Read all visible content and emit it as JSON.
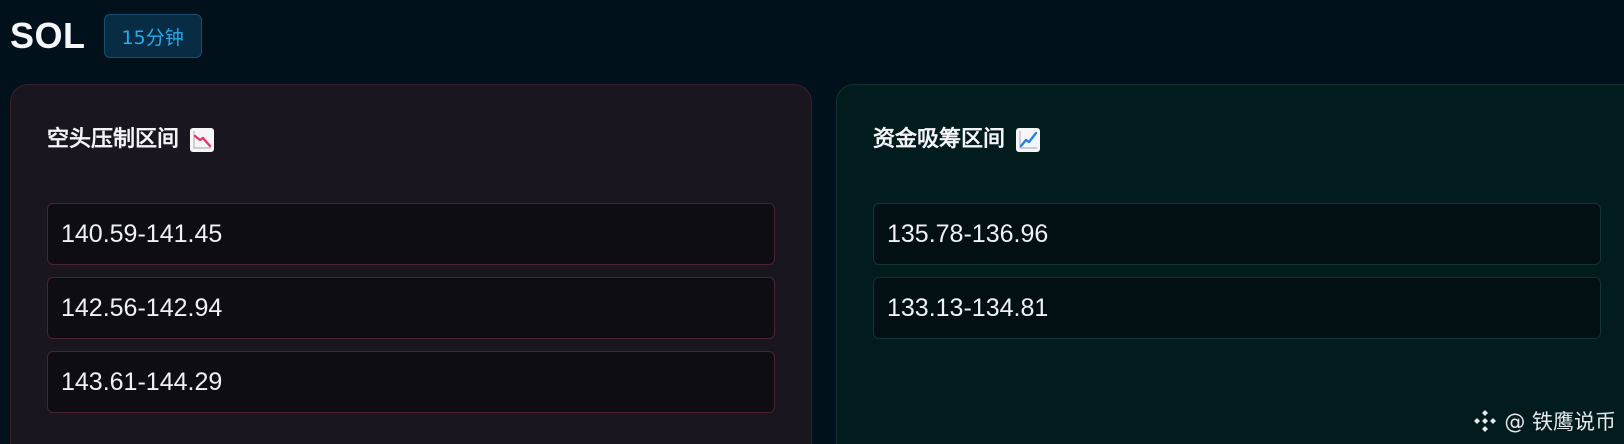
{
  "header": {
    "symbol": "SOL",
    "timeframe": "15分钟"
  },
  "short_zone": {
    "title": "空头压制区间",
    "icon": "chart-decreasing-icon",
    "ranges": [
      "140.59-141.45",
      "142.56-142.94",
      "143.61-144.29"
    ]
  },
  "long_zone": {
    "title": "资金吸筹区间",
    "icon": "chart-increasing-icon",
    "ranges": [
      "135.78-136.96",
      "133.13-134.81"
    ]
  },
  "watermark": {
    "text": "@ 铁鹰说币",
    "icon": "binance-logo-icon"
  },
  "colors": {
    "background": "#01111b",
    "accent": "#2ba8ec",
    "short_card": "#19161f",
    "long_card": "#021b1c"
  }
}
